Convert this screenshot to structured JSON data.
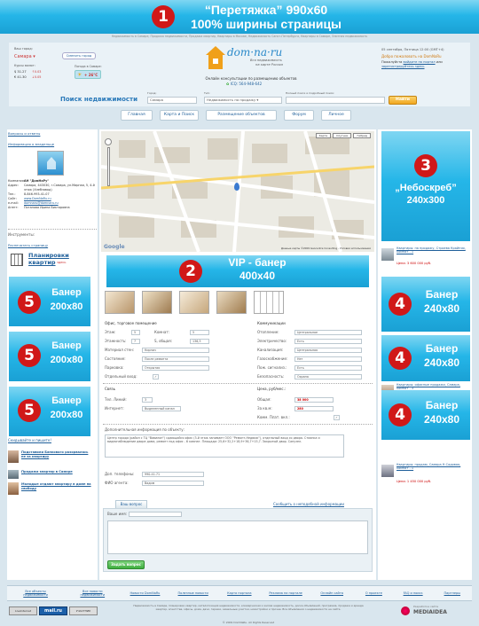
{
  "top_banner": {
    "num": "1",
    "line1": "“Перетяжка” 990x60",
    "line2": "100% ширины страницы"
  },
  "header": {
    "seo_text": "Недвижимость в Самаре, Продажа недвижимости, Продажа квартир, Квартиры в Москве, Недвижимость Санкт-Петербурга, Квартиры в Самаре, Элитная недвижимость",
    "your_city_label": "Ваш город:",
    "city": "Самара ▾",
    "change_city_btn": "Сменить город",
    "currency_label": "Курсы валют:",
    "usd": "$ 31.27",
    "usd_delta": "↑0.03",
    "eur": "€ 41.30",
    "eur_delta": "↓0.05",
    "weather_label": "Погода в Самаре:",
    "weather_temp": "+ 26°С",
    "logo_name": "dom·na·ru",
    "logo_tag1": "Вся недвижимость",
    "logo_tag2": "на карте России",
    "consult": "Онлайн консультации по размещению объектов",
    "icq": "ICQ: 564-948-642",
    "date": "05 сентября, Пятница 12:00 (GMT+4)",
    "welcome": "Добро пожаловать на DomNaRu",
    "login_prefix": "Пожалуйста",
    "login_link": "войдите на портал",
    "login_or": "или",
    "register_link": "зарегистрируйтесь здесь"
  },
  "search": {
    "title": "Поиск недвижимости",
    "city_label": "Город:",
    "city_value": "Самара",
    "type_label": "Тип:",
    "type_value": "Недвижимость на продажу ▾",
    "detail_label": "Полный поиск и подробный поиск:",
    "find_btn": "Найти"
  },
  "nav": [
    "Главная",
    "Карта и Поиск",
    "Размещение объектов",
    "Форум",
    "Личное"
  ],
  "sidebar": {
    "qa_link": "Вопросы и ответы",
    "owner_link": "Информация о владельце",
    "company_label": "Компания:",
    "company_value": "АН \"ДомНаРу\"",
    "address_label": "Адрес:",
    "address_value": "Самара, 443030, г.Самара, ул.Мирная, 5, 4-й этаж (Хлебзавод)",
    "phone_label": "Тел.:",
    "phone_value": "8-846-993-41-07",
    "site_label": "Сайт:",
    "site_value": "www.DomNaRu.ru",
    "email_label": "e-mail:",
    "email_value": "domnaru@domnaru.ru",
    "agent_label": "Агент:",
    "agent_value": "Потапова Ирина Викторовна",
    "tools_label": "Инструменты:",
    "print_link": "Распечатать страницу",
    "plan_link1": "Планировки",
    "plan_link2": "квартир",
    "plan_small": "здесь",
    "news_title": "Скидывайте и пишите!",
    "news": [
      {
        "text": "Подставили Банкового разорвалась не за квартиру"
      },
      {
        "text": "Продажа квартир в Самаре"
      },
      {
        "text": "Молодые отдают квартиру в доме на свободу"
      }
    ]
  },
  "ads": {
    "vip": {
      "num": "2",
      "line1": "VIP - банер",
      "line2": "400x40"
    },
    "sky": {
      "num": "3",
      "line1": "„Небоскреб”",
      "line2": "240x300"
    },
    "left": [
      {
        "num": "5",
        "line1": "Банер",
        "line2": "200x80"
      },
      {
        "num": "5",
        "line1": "Банер",
        "line2": "200x80"
      },
      {
        "num": "5",
        "line1": "Банер",
        "line2": "200x80"
      }
    ],
    "right": [
      {
        "num": "4",
        "line1": "Банер",
        "line2": "240x80"
      },
      {
        "num": "4",
        "line1": "Банер",
        "line2": "240x80"
      },
      {
        "num": "4",
        "line1": "Банер",
        "line2": "240x80"
      }
    ]
  },
  "right_listings": [
    {
      "title": "Квартиры: на продажу, Строева Крайняя, комнат - 1",
      "price": "Цена: 3 600 000 руб."
    },
    {
      "title": "Квартиры: офисные продажи, Самара, комнат - 3",
      "price": "Цена: 3 000 000 руб."
    },
    {
      "title": "Квартиры: продаю, Самара Н-Садовая, комнат - 1",
      "price": "Цена: 1 450 000 руб."
    }
  ],
  "map": {
    "tabs": [
      "Карта",
      "Спутник",
      "Гибрид"
    ],
    "google": "Google",
    "copyright": "Данные карты ©2009 Geocentre Consulting - Условия использования"
  },
  "details": {
    "type": "Офис, торговое помещение",
    "left": [
      {
        "label": "Этаж:",
        "value": "5"
      },
      {
        "label": "Этажность:",
        "value": "7"
      },
      {
        "label": "Материал стен:",
        "value": "Кирпич"
      },
      {
        "label": "Состояние:",
        "value": "После ремонта"
      },
      {
        "label": "Парковка:",
        "value": "Открытая"
      },
      {
        "label": "Отдельный вход:",
        "value": "✓"
      }
    ],
    "rooms_label": "Комнат:",
    "rooms_value": "5",
    "area_label": "S, общая:",
    "area_value": "136,3",
    "comm_title": "Коммуникации",
    "right": [
      {
        "label": "Отопление:",
        "value": "Центральное"
      },
      {
        "label": "Электричество:",
        "value": "Есть"
      },
      {
        "label": "Канализация:",
        "value": "Центральная"
      },
      {
        "label": "Газоснабжение:",
        "value": "Нет"
      },
      {
        "label": "Пож. сигнализ.:",
        "value": "Есть"
      },
      {
        "label": "Безопасность:",
        "value": "Охрана"
      }
    ],
    "link_title": "Связь",
    "tel_label": "Тел. Линий:",
    "tel_value": "3",
    "inet_label": "Интернет:",
    "inet_value": "Выделенный канал",
    "price_title": "Цена, руб/мес.:",
    "total_label": "Общая:",
    "total_value": "38 000",
    "m2_label": "За кв.м:",
    "m2_value": "280",
    "util_label": "Комм. Плат. вкл.:",
    "util_value": "✓",
    "extra_label": "Дополнительная информация по объекту:",
    "extra_text": "Центр города (район с ТЦ \"Вавилон\") сдающийся офис (3-й этаж занимает ООО \"Ремонт-Недвиж\"), отдельный вход со двора. Стоянка и видеонаблюдение дворе дома, ремонт под офис - 6 комнат. Площади: 25,6+32,2+18,9+36,7+15,7. Закрытый двор. Санузел.",
    "phone2_label": "Доп. телефоны:",
    "phone2_value": "990-41-71",
    "agent_label": "ФИО агента:",
    "agent_value": "Вадим"
  },
  "question": {
    "tab": "Ваш вопрос",
    "report_link": "Сообщить о неподобной информации",
    "name_label": "Ваше имя:",
    "submit": "Задать вопрос"
  },
  "footer": {
    "links": [
      "Все объекты недвижимости",
      "Все новости недвижимости",
      "Новости DomNaRu",
      "Полезные новости",
      "Карта портала",
      "Реклама на портале",
      "Онлайн сайта",
      "О проекте",
      "FAQ и поиск",
      "Партнеры"
    ],
    "text": "Недвижимость в Самаре, планировки квартир, каталогизация недвижимости, коммерческая и жилая недвижимость, доска объявлений, программа, продажа и аренда квартир, агентства, офисы, дома, дачи, гаражи, земельные участки, новостройки и прочее. Все объявления о недвижимости на сайте.",
    "copyright": "© 2009 DomNaRu. All Rights Reserved",
    "badges": [
      "LiveInternet",
      "mail.ru",
      "УЧАСТНИК"
    ],
    "mediaidea": "MEDIAIDEA",
    "created": "Разработка сайта"
  }
}
